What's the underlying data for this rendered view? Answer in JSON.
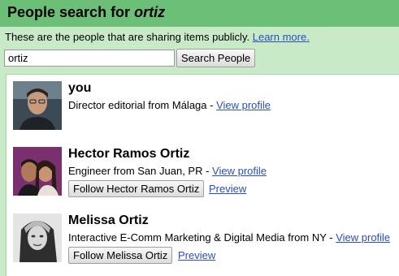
{
  "header": {
    "title_prefix": "People search for",
    "title_query": "ortiz"
  },
  "intro": {
    "text": "These are the people that are sharing items publicly.",
    "learn_more": "Learn more."
  },
  "search": {
    "value": "ortiz",
    "button_label": "Search People"
  },
  "people": [
    {
      "name": "you",
      "info": "Director editorial from Málaga - ",
      "view_profile": "View profile"
    },
    {
      "name": "Hector Ramos Ortiz",
      "info": "Engineer from San Juan, PR - ",
      "view_profile": "View profile",
      "follow_label": "Follow Hector Ramos Ortiz",
      "preview_label": "Preview"
    },
    {
      "name": "Melissa Ortiz",
      "info": "Interactive E-Comm Marketing & Digital Media from NY - ",
      "view_profile": "View profile",
      "follow_label": "Follow Melissa Ortiz",
      "preview_label": "Preview"
    }
  ],
  "colors": {
    "header_bg": "#6cbf77",
    "panel_bg": "#c9eac6",
    "link": "#2a4fbf"
  }
}
